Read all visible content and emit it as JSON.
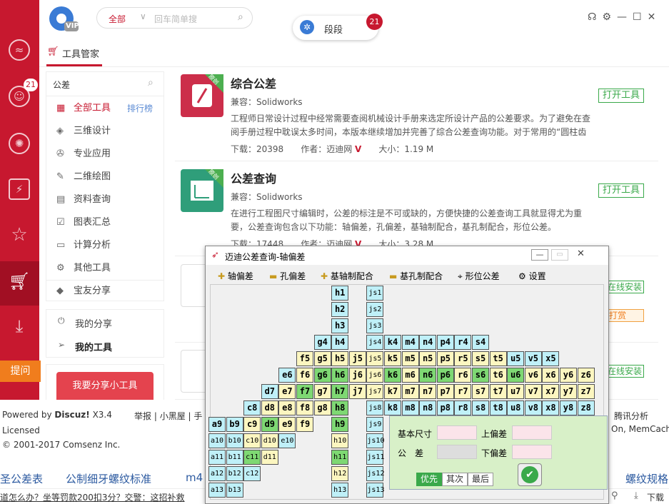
{
  "header": {
    "logo_badge": "VIP",
    "search_scope": "全部",
    "search_placeholder": "回车简单搜",
    "toast_label": "段段",
    "toast_count": "21"
  },
  "sidebar": {
    "badge": "21",
    "ask_label": "提问"
  },
  "tabs": {
    "active": "工具管家"
  },
  "leftmenu": {
    "search_value": "公差",
    "items": [
      {
        "label": "全部工具",
        "extra": "排行榜"
      },
      {
        "label": "三维设计"
      },
      {
        "label": "专业应用"
      },
      {
        "label": "二维绘图"
      },
      {
        "label": "资料查询"
      },
      {
        "label": "图表汇总"
      },
      {
        "label": "计算分析"
      },
      {
        "label": "其他工具"
      },
      {
        "label": "宝友分享"
      }
    ],
    "my_share": "我的分享",
    "my_tools": "我的工具",
    "share_btn": "我要分享小工具"
  },
  "cards": [
    {
      "title": "综合公差",
      "compat": "兼容：Solidworks",
      "desc": "工程师日常设计过程中经常需要查阅机械设计手册来选定所设计产品的公差要求。为了避免在查阅手册过程中耽误太多时间，本版本继续增加并完善了综合公差查询功能。对于常用的“圆柱齿",
      "downloads": "下载：20398",
      "author": "作者：迈迪网",
      "size": "大小：1.19 M",
      "btn": "打开工具",
      "ribbon": "原创"
    },
    {
      "title": "公差查询",
      "compat": "兼容：Solidworks",
      "desc": "在进行工程图尺寸编辑时，公差的标注是不可或缺的，方便快捷的公差查询工具就显得尤为重要，公差查询包含以下功能：轴偏差，孔偏差，基轴制配合，基孔制配合，形位公差。",
      "downloads": "下载：17448",
      "author": "作者：迈迪网",
      "size": "大小：3.28 M",
      "btn": "打开工具",
      "ribbon": "原创"
    }
  ],
  "right_buttons": [
    "在线安装",
    "打赏",
    "在线安装"
  ],
  "footer": {
    "powered": "Powered by",
    "discuz": "Discuz!",
    "ver": "X3.4",
    "licensed": "Licensed",
    "copyright": "© 2001-2017 Comsenz Inc.",
    "links": [
      "举报",
      "小黑屋",
      "手"
    ],
    "right1": "腾讯分析",
    "right2": "On, MemCache"
  },
  "taglinks": [
    "圣公差表",
    "公制细牙螺纹标准",
    "m4",
    "螺纹规格"
  ],
  "bottomstrip": {
    "text": "道怎么办？坐等罚款200扣3分？交警：这招补救",
    "download": "下载"
  },
  "dialog": {
    "title": "迈迪公差查询-轴偏差",
    "toolbar": [
      "轴偏差",
      "孔偏差",
      "基轴制配合",
      "基孔制配合",
      "形位公差",
      "设置"
    ],
    "panel": {
      "basic_size": "基本尺寸",
      "upper": "上偏差",
      "tolerance": "公　差",
      "lower": "下偏差",
      "btn_priority": "优先",
      "btn_second": "其次",
      "btn_last": "最后"
    }
  },
  "grid_cells": [
    {
      "t": "h1",
      "c": 13,
      "r": 0,
      "k": "b"
    },
    {
      "t": "h2",
      "c": 13,
      "r": 1,
      "k": "b"
    },
    {
      "t": "h3",
      "c": 13,
      "r": 2,
      "k": "b"
    },
    {
      "t": "js1",
      "c": 15,
      "r": 0,
      "k": "b"
    },
    {
      "t": "js2",
      "c": 15,
      "r": 1,
      "k": "b"
    },
    {
      "t": "js3",
      "c": 15,
      "r": 2,
      "k": "b"
    },
    {
      "t": "g4",
      "c": 12,
      "r": 3,
      "k": "b"
    },
    {
      "t": "h4",
      "c": 13,
      "r": 3,
      "k": "b"
    },
    {
      "t": "js4",
      "c": 15,
      "r": 3,
      "k": "b"
    },
    {
      "t": "k4",
      "c": 16,
      "r": 3,
      "k": "b"
    },
    {
      "t": "m4",
      "c": 17,
      "r": 3,
      "k": "b"
    },
    {
      "t": "n4",
      "c": 18,
      "r": 3,
      "k": "b"
    },
    {
      "t": "p4",
      "c": 19,
      "r": 3,
      "k": "b"
    },
    {
      "t": "r4",
      "c": 20,
      "r": 3,
      "k": "b"
    },
    {
      "t": "s4",
      "c": 21,
      "r": 3,
      "k": "b"
    },
    {
      "t": "f5",
      "c": 11,
      "r": 4,
      "k": "y"
    },
    {
      "t": "g5",
      "c": 12,
      "r": 4,
      "k": "y"
    },
    {
      "t": "h5",
      "c": 13,
      "r": 4,
      "k": "y"
    },
    {
      "t": "j5",
      "c": 14,
      "r": 4,
      "k": "y"
    },
    {
      "t": "js5",
      "c": 15,
      "r": 4,
      "k": "y"
    },
    {
      "t": "k5",
      "c": 16,
      "r": 4,
      "k": "y"
    },
    {
      "t": "m5",
      "c": 17,
      "r": 4,
      "k": "y"
    },
    {
      "t": "n5",
      "c": 18,
      "r": 4,
      "k": "y"
    },
    {
      "t": "p5",
      "c": 19,
      "r": 4,
      "k": "y"
    },
    {
      "t": "r5",
      "c": 20,
      "r": 4,
      "k": "y"
    },
    {
      "t": "s5",
      "c": 21,
      "r": 4,
      "k": "y"
    },
    {
      "t": "t5",
      "c": 22,
      "r": 4,
      "k": "y"
    },
    {
      "t": "u5",
      "c": 23,
      "r": 4,
      "k": "b"
    },
    {
      "t": "v5",
      "c": 24,
      "r": 4,
      "k": "b"
    },
    {
      "t": "x5",
      "c": 25,
      "r": 4,
      "k": "b"
    },
    {
      "t": "e6",
      "c": 10,
      "r": 5,
      "k": "b"
    },
    {
      "t": "f6",
      "c": 11,
      "r": 5,
      "k": "y"
    },
    {
      "t": "g6",
      "c": 12,
      "r": 5,
      "k": "g"
    },
    {
      "t": "h6",
      "c": 13,
      "r": 5,
      "k": "g"
    },
    {
      "t": "j6",
      "c": 14,
      "r": 5,
      "k": "y"
    },
    {
      "t": "js6",
      "c": 15,
      "r": 5,
      "k": "y"
    },
    {
      "t": "k6",
      "c": 16,
      "r": 5,
      "k": "g"
    },
    {
      "t": "m6",
      "c": 17,
      "r": 5,
      "k": "y"
    },
    {
      "t": "n6",
      "c": 18,
      "r": 5,
      "k": "g"
    },
    {
      "t": "p6",
      "c": 19,
      "r": 5,
      "k": "g"
    },
    {
      "t": "r6",
      "c": 20,
      "r": 5,
      "k": "y"
    },
    {
      "t": "s6",
      "c": 21,
      "r": 5,
      "k": "g"
    },
    {
      "t": "t6",
      "c": 22,
      "r": 5,
      "k": "y"
    },
    {
      "t": "u6",
      "c": 23,
      "r": 5,
      "k": "g"
    },
    {
      "t": "v6",
      "c": 24,
      "r": 5,
      "k": "y"
    },
    {
      "t": "x6",
      "c": 25,
      "r": 5,
      "k": "y"
    },
    {
      "t": "y6",
      "c": 26,
      "r": 5,
      "k": "y"
    },
    {
      "t": "z6",
      "c": 27,
      "r": 5,
      "k": "y"
    },
    {
      "t": "d7",
      "c": 9,
      "r": 6,
      "k": "b"
    },
    {
      "t": "e7",
      "c": 10,
      "r": 6,
      "k": "y"
    },
    {
      "t": "f7",
      "c": 11,
      "r": 6,
      "k": "g"
    },
    {
      "t": "g7",
      "c": 12,
      "r": 6,
      "k": "y"
    },
    {
      "t": "h7",
      "c": 13,
      "r": 6,
      "k": "g"
    },
    {
      "t": "j7",
      "c": 14,
      "r": 6,
      "k": "y"
    },
    {
      "t": "js7",
      "c": 15,
      "r": 6,
      "k": "y"
    },
    {
      "t": "k7",
      "c": 16,
      "r": 6,
      "k": "y"
    },
    {
      "t": "m7",
      "c": 17,
      "r": 6,
      "k": "y"
    },
    {
      "t": "n7",
      "c": 18,
      "r": 6,
      "k": "y"
    },
    {
      "t": "p7",
      "c": 19,
      "r": 6,
      "k": "y"
    },
    {
      "t": "r7",
      "c": 20,
      "r": 6,
      "k": "y"
    },
    {
      "t": "s7",
      "c": 21,
      "r": 6,
      "k": "y"
    },
    {
      "t": "t7",
      "c": 22,
      "r": 6,
      "k": "y"
    },
    {
      "t": "u7",
      "c": 23,
      "r": 6,
      "k": "y"
    },
    {
      "t": "v7",
      "c": 24,
      "r": 6,
      "k": "y"
    },
    {
      "t": "x7",
      "c": 25,
      "r": 6,
      "k": "y"
    },
    {
      "t": "y7",
      "c": 26,
      "r": 6,
      "k": "y"
    },
    {
      "t": "z7",
      "c": 27,
      "r": 6,
      "k": "y"
    },
    {
      "t": "c8",
      "c": 8,
      "r": 7,
      "k": "b"
    },
    {
      "t": "d8",
      "c": 9,
      "r": 7,
      "k": "y"
    },
    {
      "t": "e8",
      "c": 10,
      "r": 7,
      "k": "y"
    },
    {
      "t": "f8",
      "c": 11,
      "r": 7,
      "k": "y"
    },
    {
      "t": "g8",
      "c": 12,
      "r": 7,
      "k": "y"
    },
    {
      "t": "h8",
      "c": 13,
      "r": 7,
      "k": "g"
    },
    {
      "t": "js8",
      "c": 15,
      "r": 7,
      "k": "b"
    },
    {
      "t": "k8",
      "c": 16,
      "r": 7,
      "k": "b"
    },
    {
      "t": "m8",
      "c": 17,
      "r": 7,
      "k": "b"
    },
    {
      "t": "n8",
      "c": 18,
      "r": 7,
      "k": "b"
    },
    {
      "t": "p8",
      "c": 19,
      "r": 7,
      "k": "b"
    },
    {
      "t": "r8",
      "c": 20,
      "r": 7,
      "k": "b"
    },
    {
      "t": "s8",
      "c": 21,
      "r": 7,
      "k": "b"
    },
    {
      "t": "t8",
      "c": 22,
      "r": 7,
      "k": "b"
    },
    {
      "t": "u8",
      "c": 23,
      "r": 7,
      "k": "b"
    },
    {
      "t": "v8",
      "c": 24,
      "r": 7,
      "k": "b"
    },
    {
      "t": "x8",
      "c": 25,
      "r": 7,
      "k": "b"
    },
    {
      "t": "y8",
      "c": 26,
      "r": 7,
      "k": "b"
    },
    {
      "t": "z8",
      "c": 27,
      "r": 7,
      "k": "b"
    },
    {
      "t": "a9",
      "c": 6,
      "r": 8,
      "k": "b"
    },
    {
      "t": "b9",
      "c": 7,
      "r": 8,
      "k": "b"
    },
    {
      "t": "c9",
      "c": 8,
      "r": 8,
      "k": "y"
    },
    {
      "t": "d9",
      "c": 9,
      "r": 8,
      "k": "g"
    },
    {
      "t": "e9",
      "c": 10,
      "r": 8,
      "k": "y"
    },
    {
      "t": "f9",
      "c": 11,
      "r": 8,
      "k": "y"
    },
    {
      "t": "h9",
      "c": 13,
      "r": 8,
      "k": "g"
    },
    {
      "t": "js9",
      "c": 15,
      "r": 8,
      "k": "b"
    },
    {
      "t": "a10",
      "c": 6,
      "r": 9,
      "k": "b"
    },
    {
      "t": "b10",
      "c": 7,
      "r": 9,
      "k": "b"
    },
    {
      "t": "c10",
      "c": 8,
      "r": 9,
      "k": "y"
    },
    {
      "t": "d10",
      "c": 9,
      "r": 9,
      "k": "y"
    },
    {
      "t": "e10",
      "c": 10,
      "r": 9,
      "k": "b"
    },
    {
      "t": "h10",
      "c": 13,
      "r": 9,
      "k": "y"
    },
    {
      "t": "js10",
      "c": 15,
      "r": 9,
      "k": "b"
    },
    {
      "t": "a11",
      "c": 6,
      "r": 10,
      "k": "b"
    },
    {
      "t": "b11",
      "c": 7,
      "r": 10,
      "k": "b"
    },
    {
      "t": "c11",
      "c": 8,
      "r": 10,
      "k": "g"
    },
    {
      "t": "d11",
      "c": 9,
      "r": 10,
      "k": "y"
    },
    {
      "t": "h11",
      "c": 13,
      "r": 10,
      "k": "g"
    },
    {
      "t": "js11",
      "c": 15,
      "r": 10,
      "k": "b"
    },
    {
      "t": "a12",
      "c": 6,
      "r": 11,
      "k": "b"
    },
    {
      "t": "b12",
      "c": 7,
      "r": 11,
      "k": "b"
    },
    {
      "t": "c12",
      "c": 8,
      "r": 11,
      "k": "b"
    },
    {
      "t": "h12",
      "c": 13,
      "r": 11,
      "k": "y"
    },
    {
      "t": "js12",
      "c": 15,
      "r": 11,
      "k": "b"
    },
    {
      "t": "a13",
      "c": 6,
      "r": 12,
      "k": "b"
    },
    {
      "t": "b13",
      "c": 7,
      "r": 12,
      "k": "b"
    },
    {
      "t": "h13",
      "c": 13,
      "r": 12,
      "k": "b"
    },
    {
      "t": "js13",
      "c": 15,
      "r": 12,
      "k": "b"
    }
  ],
  "colors": {
    "brand_red": "#c7182f",
    "cell_blue": "#bff0f8",
    "cell_yellow": "#fcf6c0",
    "cell_green": "#7ed873",
    "open_green": "#3aa94a"
  }
}
